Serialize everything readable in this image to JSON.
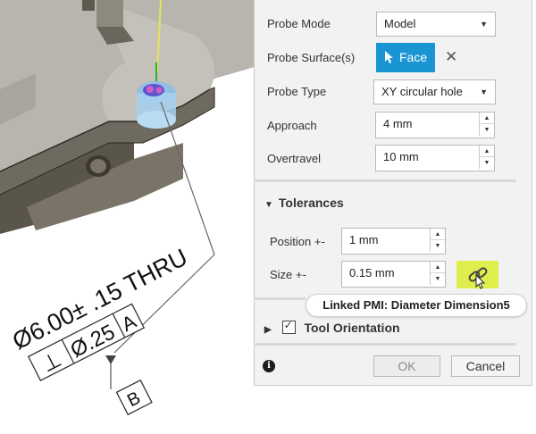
{
  "canvas": {
    "annotation": {
      "dimension_text": "Ø6.00± .15 THRU",
      "perpendicular_symbol": "⊥",
      "tolerance_value": "Ø.25",
      "datum_a": "A",
      "datum_b": "B"
    }
  },
  "panel": {
    "probe_mode": {
      "label": "Probe Mode",
      "value": "Model"
    },
    "probe_surfaces": {
      "label": "Probe Surface(s)",
      "selection": "Face"
    },
    "probe_type": {
      "label": "Probe Type",
      "value": "XY circular hole"
    },
    "approach": {
      "label": "Approach",
      "value": "4 mm"
    },
    "overtravel": {
      "label": "Overtravel",
      "value": "10 mm"
    },
    "tolerances": {
      "header": "Tolerances",
      "position": {
        "label": "Position +-",
        "value": "1 mm"
      },
      "size": {
        "label": "Size +-",
        "value": "0.15 mm"
      }
    },
    "tooltip": "Linked PMI: Diameter Dimension5",
    "tool_orientation": {
      "label": "Tool Orientation",
      "checked": true
    },
    "footer": {
      "ok": "OK",
      "cancel": "Cancel"
    }
  },
  "colors": {
    "accent": "#1a95d3",
    "link_highlight": "#dfee4c"
  }
}
